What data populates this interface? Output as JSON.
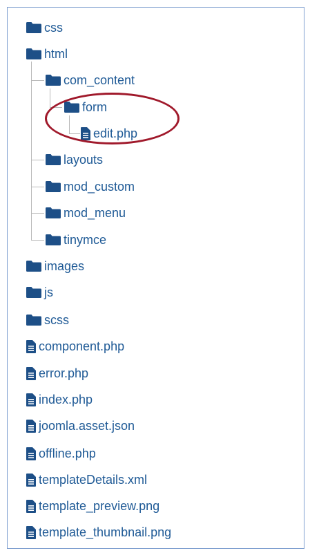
{
  "tree": {
    "css": "css",
    "html": "html",
    "com_content": "com_content",
    "form": "form",
    "edit_php": "edit.php",
    "layouts": "layouts",
    "mod_custom": "mod_custom",
    "mod_menu": "mod_menu",
    "tinymce": "tinymce",
    "images": "images",
    "js": "js",
    "scss": "scss",
    "component_php": "component.php",
    "error_php": "error.php",
    "index_php": "index.php",
    "joomla_asset_json": "joomla.asset.json",
    "offline_php": "offline.php",
    "templateDetails_xml": "templateDetails.xml",
    "template_preview_png": "template_preview.png",
    "template_thumbnail_png": "template_thumbnail.png"
  },
  "colors": {
    "link": "#1f5a96",
    "icon": "#1d4f87",
    "tree_line": "#b8b8b8",
    "highlight": "#a0192b",
    "panel_border": "#7f9fd0"
  },
  "icons": {
    "folder": "folder-icon",
    "file": "file-icon"
  }
}
